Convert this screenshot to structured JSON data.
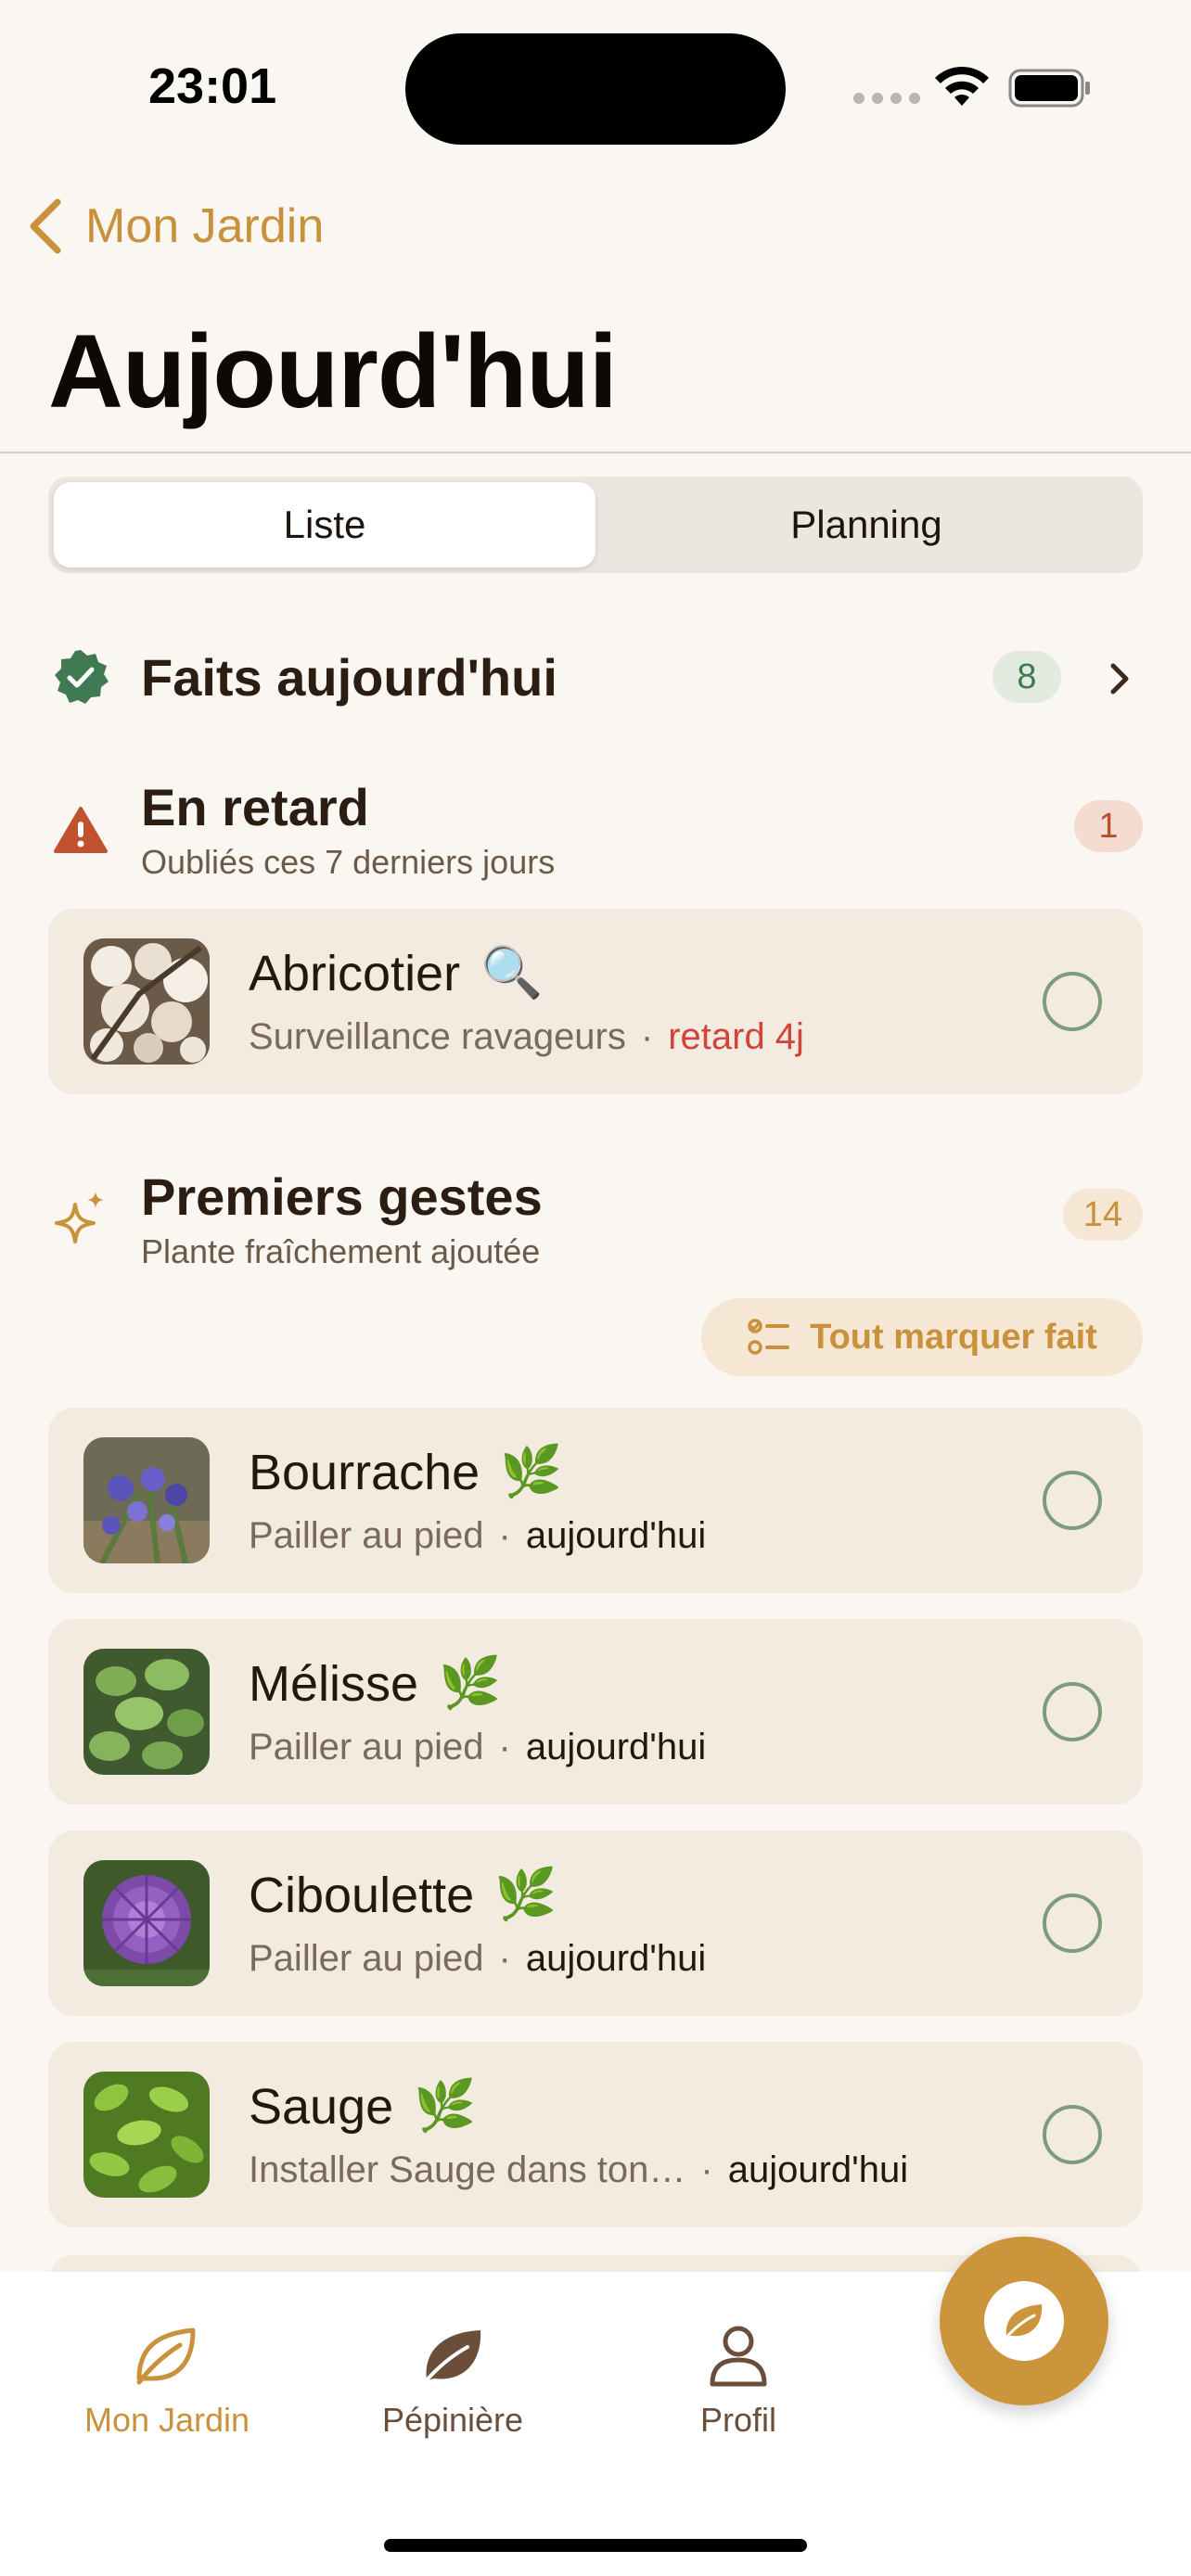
{
  "status_bar": {
    "time": "23:01"
  },
  "nav": {
    "back_label": "Mon Jardin",
    "title": "Aujourd'hui"
  },
  "segmented": {
    "options": [
      "Liste",
      "Planning"
    ],
    "selected": "Liste"
  },
  "sections": {
    "done": {
      "title": "Faits aujourd'hui",
      "count": "8"
    },
    "late": {
      "title": "En retard",
      "subtitle": "Oubliés ces 7 derniers jours",
      "count": "1",
      "items": [
        {
          "name": "Abricotier",
          "emoji": "🔍",
          "task": "Surveillance ravageurs",
          "when": "retard 4j"
        }
      ]
    },
    "first": {
      "title": "Premiers gestes",
      "subtitle": "Plante fraîchement ajoutée",
      "count": "14",
      "mark_all_label": "Tout marquer fait",
      "items": [
        {
          "name": "Bourrache",
          "emoji": "🌿",
          "task": "Pailler au pied",
          "when": "aujourd'hui"
        },
        {
          "name": "Mélisse",
          "emoji": "🌿",
          "task": "Pailler au pied",
          "when": "aujourd'hui"
        },
        {
          "name": "Ciboulette",
          "emoji": "🌿",
          "task": "Pailler au pied",
          "when": "aujourd'hui"
        },
        {
          "name": "Sauge",
          "emoji": "🌿",
          "task": "Installer Sauge dans ton…",
          "when": "aujourd'hui"
        }
      ]
    }
  },
  "separator": "·",
  "tabbar": {
    "tabs": [
      {
        "label": "Mon Jardin",
        "icon": "leaf-outline-icon",
        "active": true
      },
      {
        "label": "Pépinière",
        "icon": "leaf-filled-icon",
        "active": false
      },
      {
        "label": "Profil",
        "icon": "person-icon",
        "active": false
      }
    ]
  },
  "colors": {
    "accent": "#c9913b",
    "background": "#faf6f1",
    "card": "#f3ebe0",
    "done_green": "#3f7a52",
    "late_red": "#d0443b",
    "warning": "#c0522f"
  }
}
